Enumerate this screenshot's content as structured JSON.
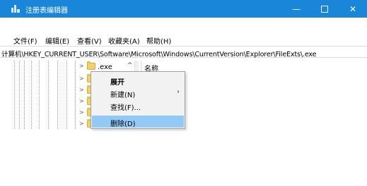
{
  "window": {
    "title": "注册表编辑器",
    "minimize_glyph": "—",
    "close_glyph": "✕"
  },
  "menu": [
    "文件(F)",
    "编辑(E)",
    "查看(V)",
    "收藏夹(A)",
    "帮助(H)"
  ],
  "address": "计算机\\HKEY_CURRENT_USER\\Software\\Microsoft\\Windows\\CurrentVersion\\Explorer\\FileExts\\.exe",
  "tree": {
    "selected_key": ".exe",
    "expand_glyph": ">",
    "scroll_up_glyph": "^"
  },
  "values_pane": {
    "column_name": "名称"
  },
  "context_menu": {
    "items": [
      {
        "label": "展开",
        "bold": true
      },
      {
        "label": "新建(N)",
        "submenu_arrow": "›"
      },
      {
        "label": "查找(F)..."
      },
      {
        "label": "删除(D)",
        "highlighted": true
      }
    ]
  },
  "colors": {
    "titlebar": "#1a86d9",
    "menu_highlight": "#91c9f7",
    "folder": "#f3d06d"
  },
  "icons": [
    "regedit-icon",
    "folder-icon",
    "chevron-right-icon",
    "scroll-up-icon",
    "submenu-arrow-icon"
  ]
}
